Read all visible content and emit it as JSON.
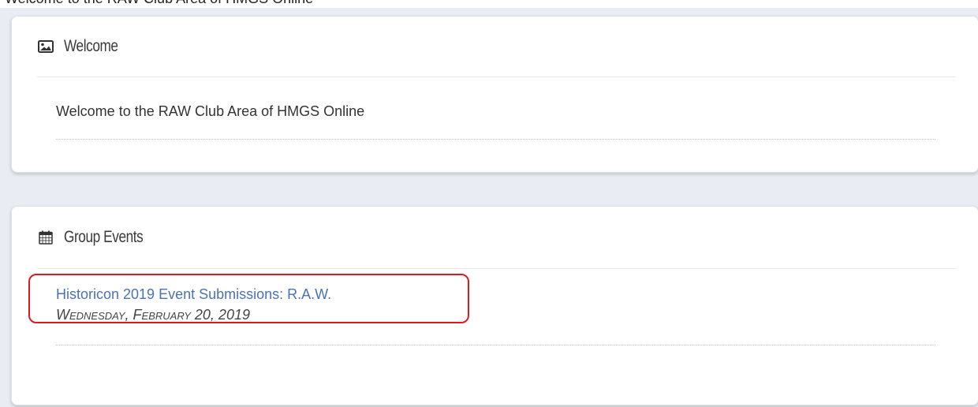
{
  "top_strip": {
    "text": "Welcome to the RAW Club Area of HMGS Online"
  },
  "welcome_card": {
    "title": "Welcome",
    "icon": "image-icon",
    "message": "Welcome to the RAW Club Area of HMGS Online"
  },
  "events_card": {
    "title": "Group Events",
    "icon": "calendar-icon",
    "events": [
      {
        "title": "Historicon 2019 Event Submissions: R.A.W.",
        "date": "Wednesday, February 20, 2019"
      }
    ]
  },
  "colors": {
    "page_background": "#e9edf3",
    "card_background": "#ffffff",
    "link": "#4b72b8",
    "highlight": "#e0191f"
  }
}
